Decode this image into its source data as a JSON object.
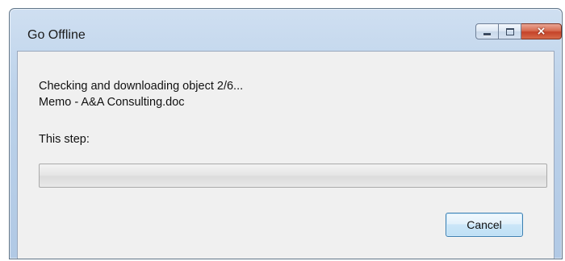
{
  "window": {
    "title": "Go Offline",
    "controls": {
      "minimize": "minimize",
      "maximize": "maximize",
      "close": "×"
    }
  },
  "body": {
    "status_line": "Checking and downloading object 2/6...",
    "file_name": "Memo - A&A Consulting.doc",
    "step_label": "This step:",
    "step_progress": 0
  },
  "buttons": {
    "cancel": "Cancel"
  },
  "colors": {
    "accent": "#3c7fb1",
    "close": "#c5432a"
  }
}
